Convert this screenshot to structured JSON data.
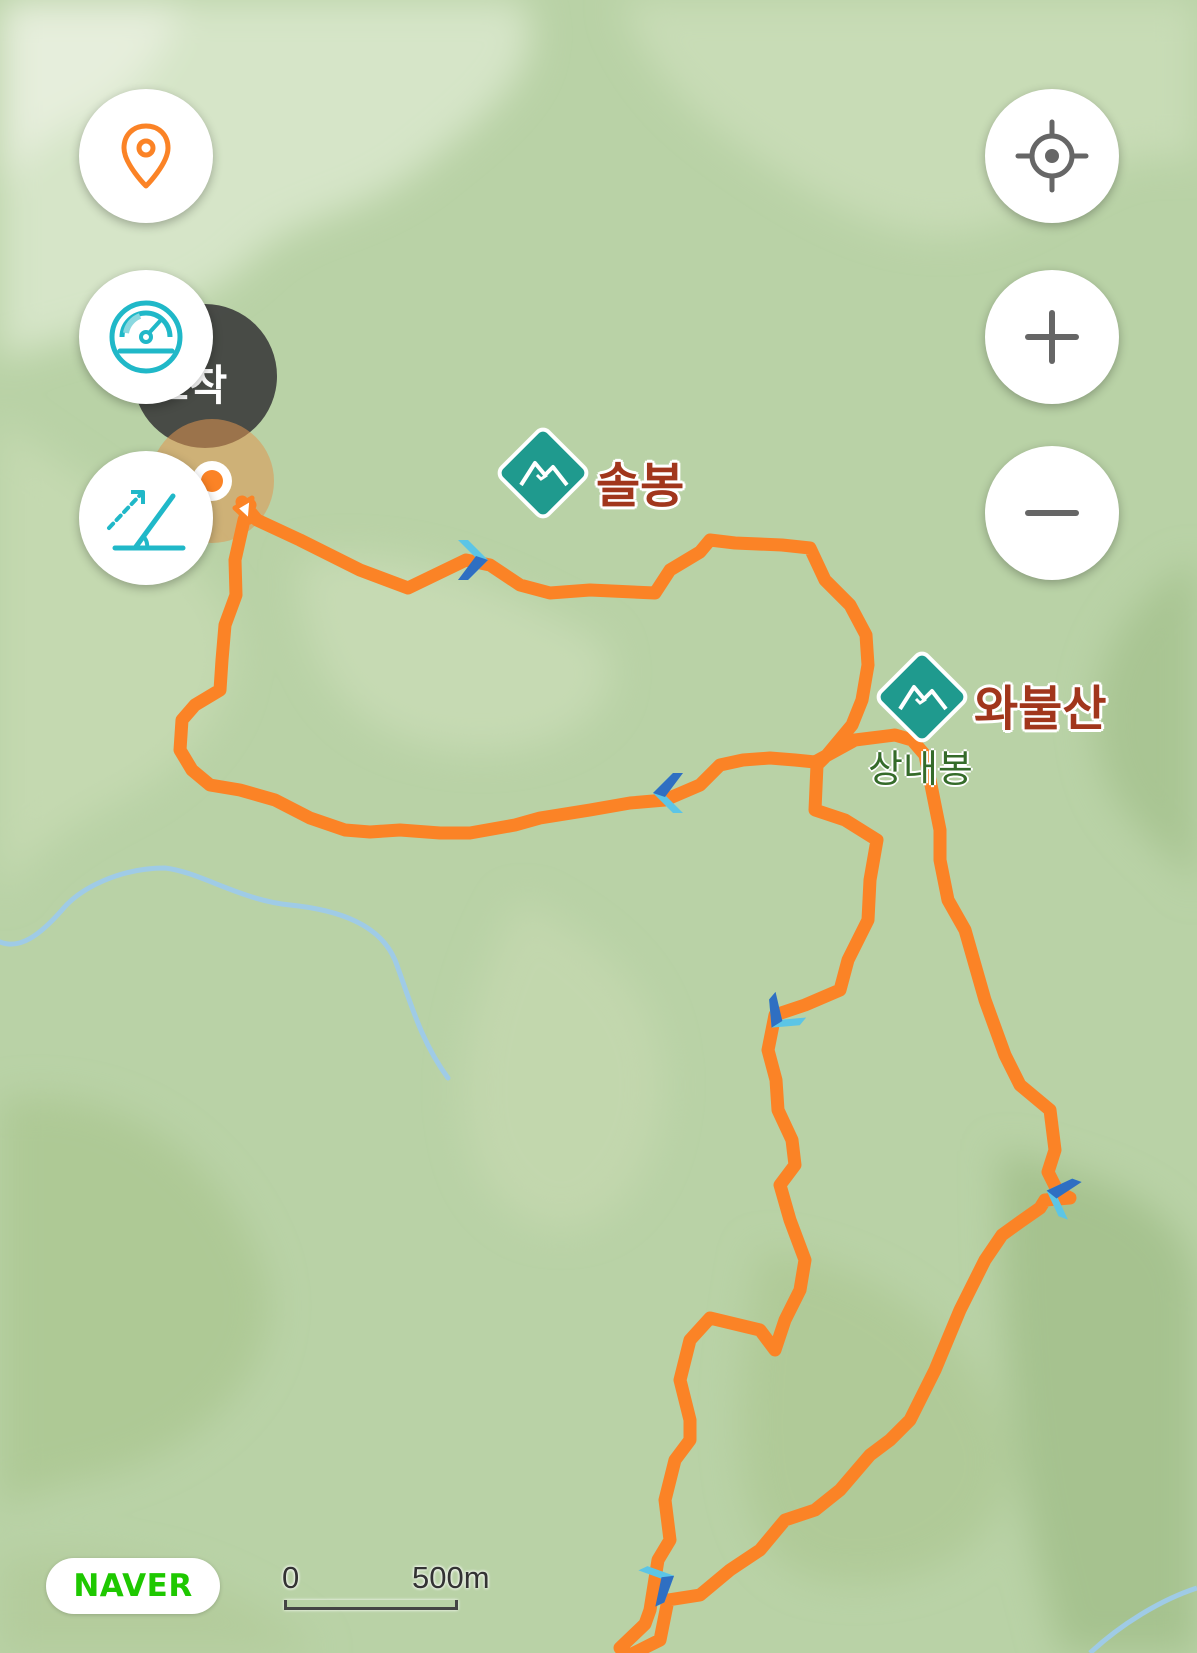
{
  "map": {
    "peaks": [
      {
        "name": "솔봉",
        "icon": "mountain-icon"
      },
      {
        "name": "와불산",
        "icon": "mountain-icon"
      }
    ],
    "sub_peak": "상내봉",
    "arrival_marker_text": "도착",
    "colors": {
      "track": "#fb8326",
      "terrain": "#b9d2a6",
      "river": "#9fcbe6",
      "peak_icon": "#1f9a8e",
      "peak_label": "#a1361c",
      "direction_arrow": "#2f6fc2"
    }
  },
  "controls": {
    "left": [
      {
        "name": "location-pin-button",
        "icon": "map-pin-icon"
      },
      {
        "name": "speed-button",
        "icon": "speedometer-icon"
      },
      {
        "name": "slope-button",
        "icon": "slope-angle-icon"
      }
    ],
    "right": [
      {
        "name": "my-location-button",
        "icon": "crosshair-icon"
      },
      {
        "name": "zoom-in-button",
        "icon": "plus-icon"
      },
      {
        "name": "zoom-out-button",
        "icon": "minus-icon"
      }
    ]
  },
  "branding": {
    "logo": "NAVER"
  },
  "scale_bar": {
    "start": "0",
    "end": "500m"
  }
}
